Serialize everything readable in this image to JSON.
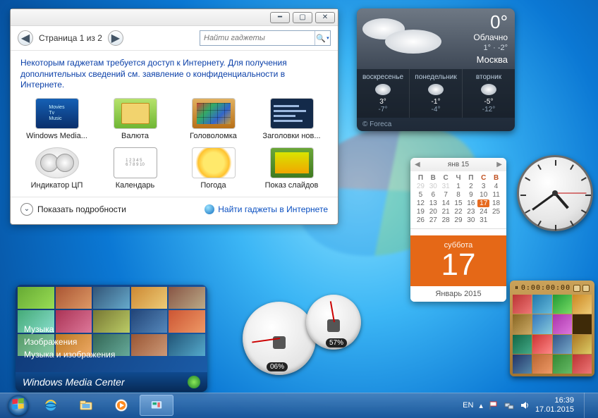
{
  "gadget_window": {
    "page_label": "Страница 1 из 2",
    "search_placeholder": "Найти гаджеты",
    "info_message": "Некоторым гаджетам требуется доступ к Интернету. Для получения дополнительных сведений см. заявление о конфиденциальности в Интернете.",
    "gadgets": [
      {
        "label": "Windows Media..."
      },
      {
        "label": "Валюта"
      },
      {
        "label": "Головоломка"
      },
      {
        "label": "Заголовки нов..."
      },
      {
        "label": "Индикатор ЦП"
      },
      {
        "label": "Календарь"
      },
      {
        "label": "Погода"
      },
      {
        "label": "Показ слайдов"
      }
    ],
    "show_details": "Показать подробности",
    "online_link": "Найти гаджеты в Интернете"
  },
  "weather": {
    "temp": "0°",
    "condition": "Облачно",
    "hi": "1°",
    "lo": "-2°",
    "city": "Москва",
    "forecast": [
      {
        "day": "воскресенье",
        "hi": "3°",
        "lo": "-7°"
      },
      {
        "day": "понедельник",
        "hi": "-1°",
        "lo": "-4°"
      },
      {
        "day": "вторник",
        "hi": "-5°",
        "lo": "-12°"
      }
    ],
    "provider": "© Foreca"
  },
  "calendar": {
    "month_header": "янв 15",
    "dow_headers": [
      "П",
      "В",
      "С",
      "Ч",
      "П",
      "С",
      "В"
    ],
    "leading_prev": [
      29,
      30,
      31
    ],
    "days": [
      1,
      2,
      3,
      4,
      5,
      6,
      7,
      8,
      9,
      10,
      11,
      12,
      13,
      14,
      15,
      16,
      17,
      18,
      19,
      20,
      21,
      22,
      23,
      24,
      25,
      26,
      27,
      28,
      29,
      30,
      31
    ],
    "today": 17,
    "big_dow": "суббота",
    "big_day": "17",
    "footer": "Январь 2015"
  },
  "clock": {
    "h_angle": 139,
    "m_angle": 234,
    "s_angle": 90
  },
  "puzzle": {
    "timer": "0:00:00:00"
  },
  "wmc_gadget": {
    "lines": [
      "Музыка",
      "Изображения",
      "Музыка и изображения"
    ],
    "footer": "Windows Media Center"
  },
  "cpu": {
    "cpu_pct": "06%",
    "ram_pct": "57%"
  },
  "taskbar": {
    "lang": "EN",
    "time": "16:39",
    "date": "17.01.2015"
  }
}
